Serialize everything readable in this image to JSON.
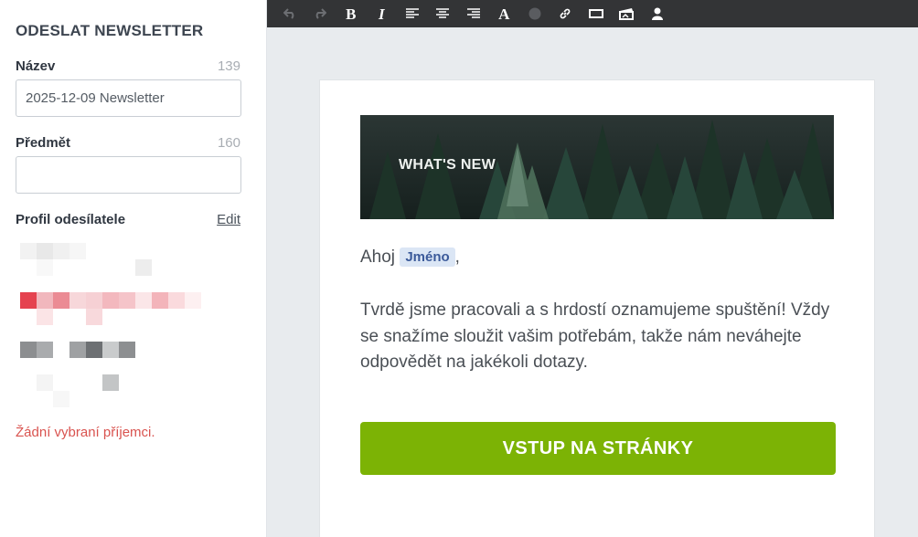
{
  "sidebar": {
    "title": "ODESLAT NEWSLETTER",
    "name_label": "Název",
    "name_count": "139",
    "name_value": "2025-12-09 Newsletter",
    "subject_label": "Předmět",
    "subject_count": "160",
    "subject_value": "",
    "profile_label": "Profil odesílatele",
    "edit_link": "Edit",
    "no_recipients": "Žádní vybraní příjemci."
  },
  "toolbar": {
    "buttons": [
      "undo-icon",
      "redo-icon",
      "bold-icon",
      "italic-icon",
      "align-left-icon",
      "align-center-icon",
      "align-right-icon",
      "font-icon",
      "color-icon",
      "link-icon",
      "button-icon",
      "image-icon",
      "merge-tag-icon"
    ],
    "bold": "B",
    "italic": "I",
    "font": "A"
  },
  "email": {
    "hero_text": "WHAT'S NEW",
    "greeting_prefix": "Ahoj",
    "name_tag": "Jméno",
    "greeting_suffix": ",",
    "body": "Tvrdě jsme pracovali a s hrdostí oznamujeme spuštění! Vždy se snažíme sloužit vašim potřebám, takže nám neváhejte odpovědět na jakékoli dotazy.",
    "cta": "VSTUP NA STRÁNKY"
  },
  "colors": {
    "cta": "#7cb305",
    "error": "#d9534f",
    "toolbar": "#333436",
    "tag_bg": "#dbe6f5"
  }
}
